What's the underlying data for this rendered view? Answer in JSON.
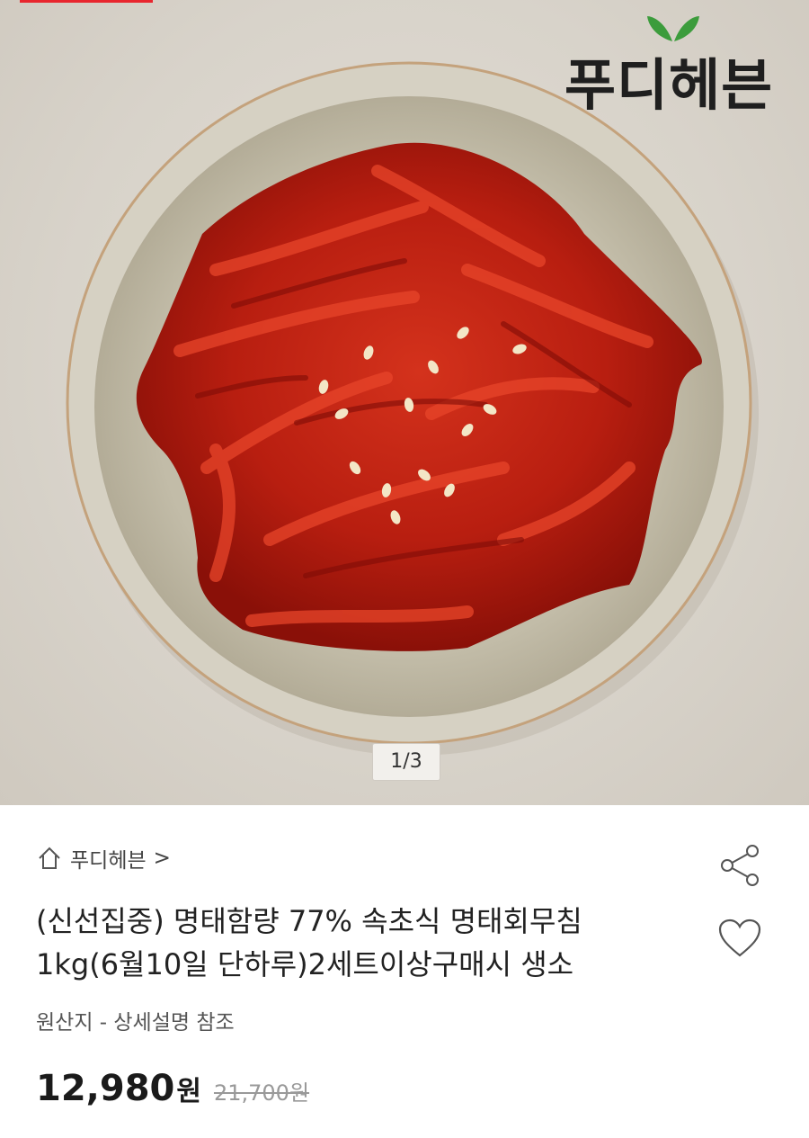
{
  "gallery": {
    "counter": "1/3",
    "brand_logo_text": "푸디헤븐",
    "accent_color": "#e8262e"
  },
  "seller": {
    "icon": "home-icon",
    "name": "푸디헤븐",
    "chevron": ">"
  },
  "product": {
    "title_line1": "(신선집중) 명태함량 77% 속초식 명태회무침",
    "title_line2": "1kg(6월10일 단하루)2세트이상구매시 생소",
    "origin": "원산지 - 상세설명 참조",
    "price": "12,980",
    "price_unit": "원",
    "original_price": "21,700원"
  },
  "actions": {
    "share_icon": "share-icon",
    "like_icon": "heart-icon"
  }
}
